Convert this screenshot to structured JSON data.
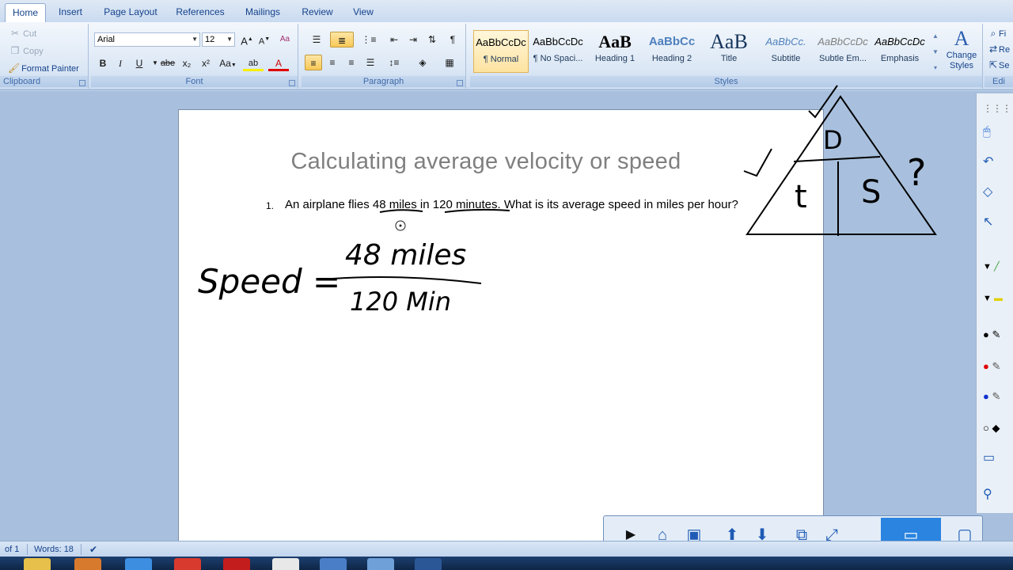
{
  "tabs": [
    "Home",
    "Insert",
    "Page Layout",
    "References",
    "Mailings",
    "Review",
    "View"
  ],
  "clipboard": {
    "cut": "Cut",
    "copy": "Copy",
    "format_painter": "Format Painter",
    "label": "Clipboard"
  },
  "font": {
    "name": "Arial",
    "size": "12",
    "grow": "A",
    "shrink": "A",
    "clear": "Aa",
    "bold": "B",
    "italic": "I",
    "underline": "U",
    "strike": "abe",
    "sub": "x₂",
    "sup": "x²",
    "change_case": "Aa",
    "highlight": "ab",
    "color": "A",
    "label": "Font"
  },
  "paragraph": {
    "label": "Paragraph",
    "pilcrow": "¶"
  },
  "styles": {
    "label": "Styles",
    "items": [
      {
        "sample": "AaBbCcDc",
        "name": "¶ Normal"
      },
      {
        "sample": "AaBbCcDc",
        "name": "¶ No Spaci..."
      },
      {
        "sample": "AaB",
        "name": "Heading 1"
      },
      {
        "sample": "AaBbCc",
        "name": "Heading 2"
      },
      {
        "sample": "AaB",
        "name": "Title"
      },
      {
        "sample": "AaBbCc.",
        "name": "Subtitle"
      },
      {
        "sample": "AaBbCcDc",
        "name": "Subtle Em..."
      },
      {
        "sample": "AaBbCcDc",
        "name": "Emphasis"
      }
    ],
    "change_styles": "Change Styles"
  },
  "editing": {
    "find": "Fi",
    "replace": "Re",
    "select": "Se",
    "label": "Edi"
  },
  "document": {
    "title": "Calculating average velocity or speed",
    "item_number": "1.",
    "question_part1": "An airplane flies ",
    "q_miles": "48 miles",
    "question_part2": " in ",
    "q_minutes": "120 minutes",
    "question_part3": ". What is its average speed in miles per hour?"
  },
  "handwriting": {
    "speed": "Speed =",
    "numerator": "48 miles",
    "denominator": "120 Min",
    "triangle_top": "D",
    "triangle_left": "t",
    "triangle_right": "S",
    "question_mark": "?"
  },
  "status": {
    "page": "of 1",
    "words": "Words: 18"
  },
  "colors": {
    "ribbon_bg": "#dbe7f5",
    "accent": "#15428b",
    "workspace": "#a8c0dd",
    "active_tool": "#2a84e0"
  }
}
